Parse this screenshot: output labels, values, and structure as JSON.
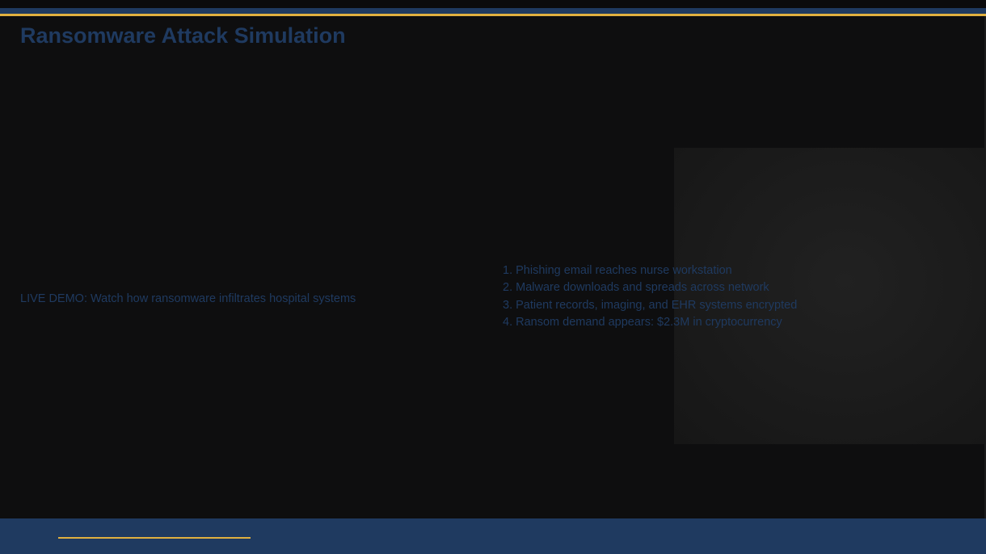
{
  "slide": {
    "title": "Ransomware Attack Simulation",
    "demo_text": "LIVE DEMO: Watch how ransomware infiltrates hospital systems",
    "steps": [
      "1. Phishing email reaches nurse workstation",
      "2. Malware downloads and spreads across network",
      "3. Patient records, imaging, and EHR systems encrypted",
      "4. Ransom demand appears: $2.3M in cryptocurrency"
    ]
  },
  "colors": {
    "background": "#0e0e0f",
    "accent_navy": "#1f3a60",
    "accent_gold": "#e0b040"
  }
}
